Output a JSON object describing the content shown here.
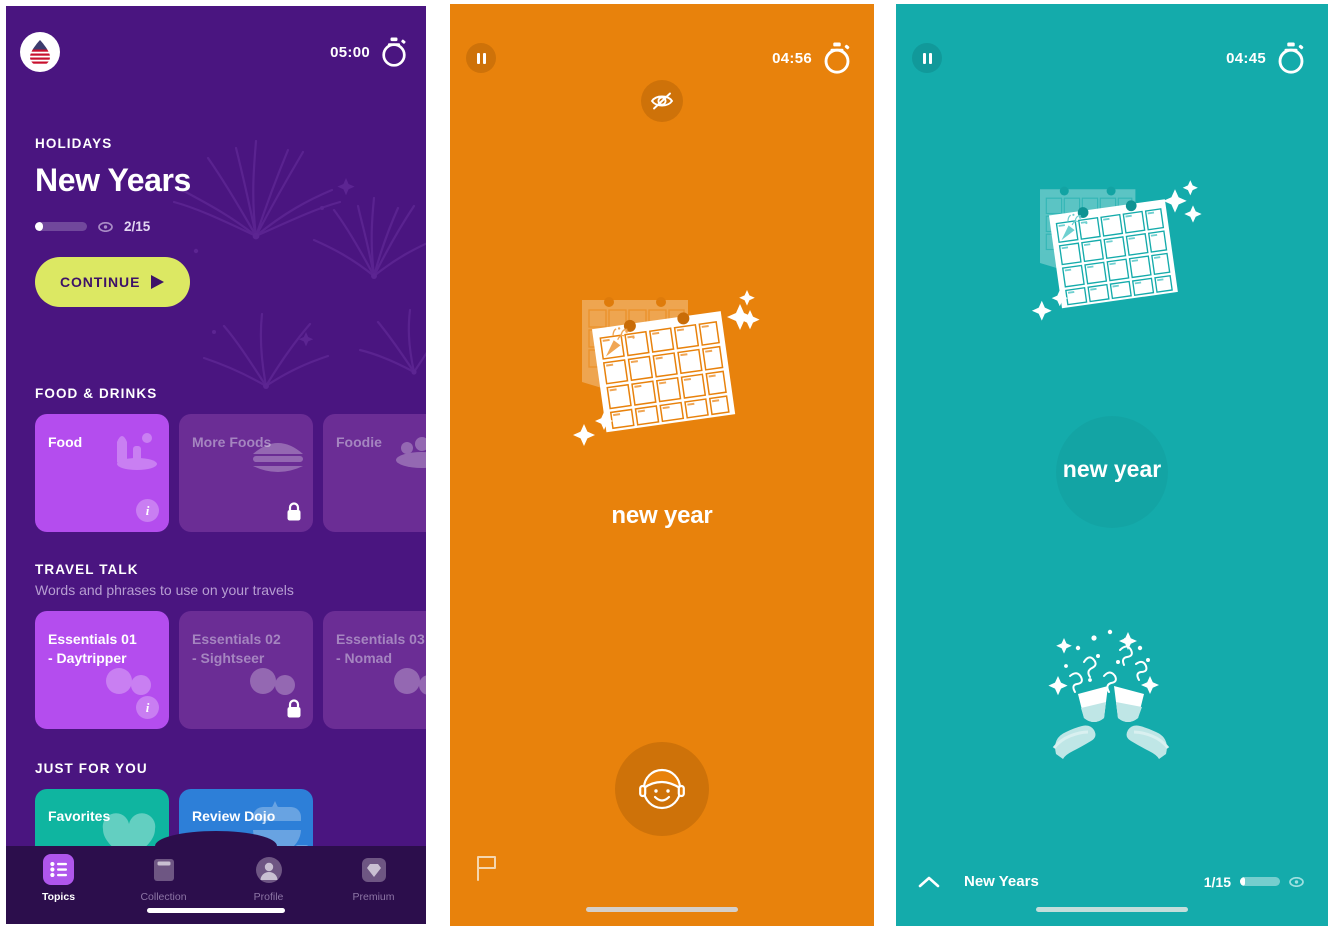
{
  "panel_topics": {
    "flag_icon": "us-flag-droplet-icon",
    "timer": "05:00",
    "timer_icon": "stopwatch-icon",
    "eyebrow": "HOLIDAYS",
    "title": "New Years",
    "progress_count": "2/15",
    "progress_percent": 13,
    "progress_eye_icon": "eye-icon",
    "continue_label": "CONTINUE",
    "continue_icon": "play-triangle-icon",
    "sections": [
      {
        "title": "FOOD & DRINKS",
        "subtitle": "",
        "cards": [
          {
            "label": "Food",
            "state": "active",
            "badge": "info",
            "art": "food-art-icon"
          },
          {
            "label": "More Foods",
            "state": "locked",
            "badge": "lock",
            "art": "burger-art-icon"
          },
          {
            "label": "Foodie",
            "state": "locked",
            "badge": "lock",
            "art": "foodie-art-icon"
          }
        ]
      },
      {
        "title": "TRAVEL TALK",
        "subtitle": "Words and phrases to use on your travels",
        "cards": [
          {
            "label": "Essentials 01 - Daytripper",
            "state": "active",
            "badge": "info",
            "art": "travel-art-icon"
          },
          {
            "label": "Essentials 02 - Sightseer",
            "state": "locked",
            "badge": "lock",
            "art": "travel-art-icon"
          },
          {
            "label": "Essentials 03 - Nomad",
            "state": "locked",
            "badge": "lock",
            "art": "travel-art-icon"
          }
        ]
      },
      {
        "title": "JUST FOR YOU",
        "subtitle": "",
        "cards": [
          {
            "label": "Favorites",
            "state": "favorites",
            "badge": "none",
            "art": "heart-icon",
            "color": "#0FB5A0"
          },
          {
            "label": "Review Dojo",
            "state": "dojo",
            "badge": "none",
            "art": "ninja-icon",
            "color": "#2D7FD8"
          }
        ]
      }
    ],
    "tabs": [
      {
        "label": "Topics",
        "icon": "list-icon",
        "active": true
      },
      {
        "label": "Collection",
        "icon": "book-icon",
        "active": false
      },
      {
        "label": "Profile",
        "icon": "person-icon",
        "active": false
      },
      {
        "label": "Premium",
        "icon": "diamond-icon",
        "active": false
      }
    ]
  },
  "panel_orange": {
    "background_color": "#E8820C",
    "pause_icon": "pause-icon",
    "timer": "04:56",
    "timer_icon": "stopwatch-icon",
    "hide_icon": "eye-slash-icon",
    "illustration": "calendar-confetti-illustration",
    "word": "new year",
    "face_icon": "face-smile-icon",
    "flag_icon": "flag-report-icon"
  },
  "panel_teal": {
    "background_color": "#14ABAB",
    "pause_icon": "pause-icon",
    "timer": "04:45",
    "timer_icon": "stopwatch-icon",
    "illustration": "calendar-confetti-illustration",
    "word": "new year",
    "illustration_2": "champagne-toast-illustration",
    "chevron_icon": "chevron-up-icon",
    "title": "New Years",
    "count": "1/15",
    "progress_percent": 12,
    "eye_icon": "eye-icon"
  }
}
